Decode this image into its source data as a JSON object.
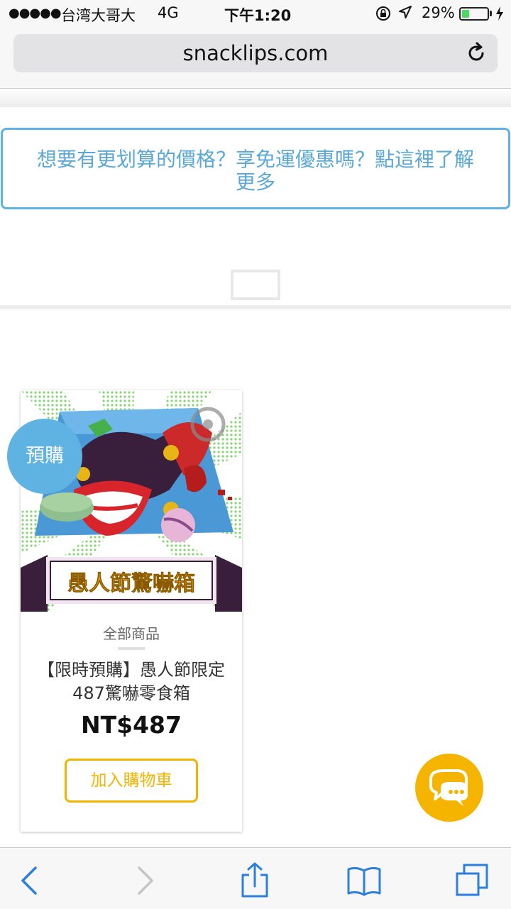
{
  "status_bar": {
    "signal": "●●●●●",
    "carrier": "台湾大哥大",
    "network": "4G",
    "time": "下午1:20",
    "battery_percent": "29%",
    "battery_level": 0.29
  },
  "browser": {
    "url": "snacklips.com",
    "icons": [
      "reload-icon",
      "back-icon",
      "forward-icon",
      "share-icon",
      "bookmarks-icon",
      "tabs-icon"
    ]
  },
  "promo": {
    "text": "想要有更划算的價格？享免運優惠嗎？點這裡了解更多"
  },
  "product": {
    "badge": "預購",
    "banner_text": "愚人節驚嚇箱",
    "category": "全部商品",
    "name": "【限時預購】愚人節限定487驚嚇零食箱",
    "price": "NT$487",
    "add_to_cart": "加入購物車"
  },
  "colors": {
    "accent_blue": "#5fb3e3",
    "accent_yellow": "#f5b400",
    "battery_green": "#4cd964"
  }
}
